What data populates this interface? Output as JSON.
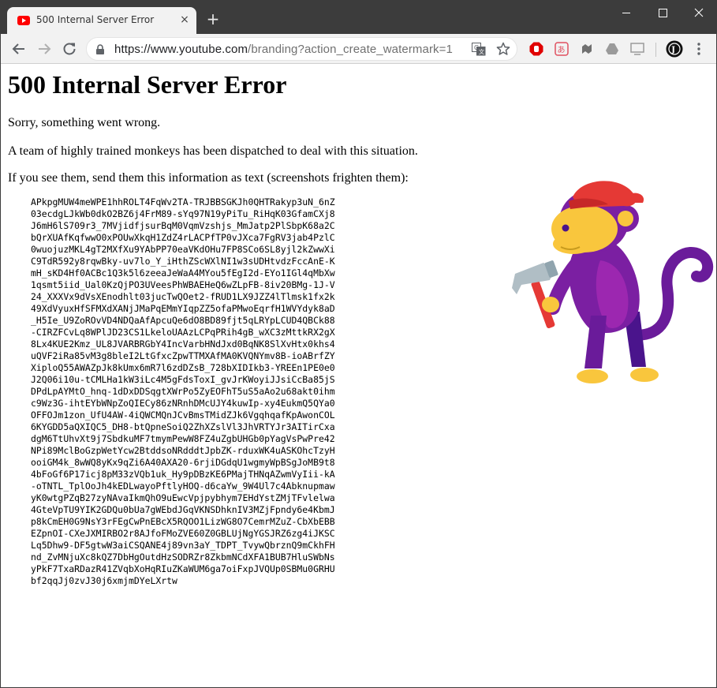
{
  "browser": {
    "tab": {
      "title": "500 Internal Server Error",
      "favicon": "youtube-icon"
    },
    "new_tab_label": "+",
    "tab_close_label": "×",
    "url_host": "https://www.youtube.com",
    "url_rest": "/branding?action_create_watermark=1",
    "colors": {
      "titlebar": "#3c3c3c",
      "toolbar": "#f2f2f2",
      "accent_red": "#ff0000"
    }
  },
  "page": {
    "title": "500 Internal Server Error",
    "line1": "Sorry, something went wrong.",
    "line2": "A team of highly trained monkeys has been dispatched to deal with this situation.",
    "line3": "If you see them, send them this information as text (screenshots frighten them):",
    "trace_lines": [
      "APkpgMUW4meWPE1hhROLT4FqWv2TA-TRJBBSGKJh0QHTRakyp3uN_6nZ",
      "03ecdgLJkWb0dkO2BZ6j4FrM89-sYq97N19yPiTu_RiHqK03GfamCXj8",
      "J6mH6lS709r3_7MVjidfjsurBqM0VqmVzshjs_MmJatp2PlSbpK68a2C",
      "bQrXUAfKqfwwO0xPOUwXkqH1ZdZ4rLACPfTP0vJXca7FgRV3jab4PzlC",
      "0wuojuzMKL4gT2MXfXu9YAbPP70eaVKdOHu7FP8SCo6SL8yjl2kZwwXi",
      "C9TdR592y8rqwBky-uv7lo_Y_iHthZScWXlNI1w3sUDHtvdzFccAnE-K",
      "mH_sKD4Hf0ACBc1Q3k5l6zeeaJeWaA4MYou5fEgI2d-EYo1IGl4qMbXw",
      "1qsmt5iid_Ual0KzQjPO3UVeesPhWBAEHeQ6wZLpFB-8iv20BMg-1J-V",
      "24_XXXVx9dVsXEnodhlt03jucTwQOet2-fRUD1LX9JZZ4lTlmsk1fx2k",
      "49XdVyuxHfSFMXdXANjJMaPqEMmYIqpZZ5ofaPMwoEqrfH1WVYdyk8aD",
      "_H5Ie_U9ZoROvVD4NDQaAfApcuQe6dO8BD89fjt5qLRYpLCUD4QBCk88",
      "-CIRZFCvLq8WPlJD23CS1LkeloUAAzLCPqPRih4gB_wXC3zMttkRX2gX",
      "8Lx4KUE2Kmz_UL8JVARBRGbY4IncVarbHNdJxd0BqNK8SlXvHtx0khs4",
      "uQVF2iRa85vM3g8bleI2LtGfxcZpwTTMXAfMA0KVQNYmv8B-ioABrfZY",
      "XiploQ55AWAZpJk8kUmx6mR7l6zdDZsB_728bXIDIkb3-YREEn1PE0e0",
      "J2Q06i10u-tCMLHa1kW3iLc4M5gFdsToxI_gvJrKWoyiJJsiCcBa85jS",
      "DPdLpAYMtO_hnq-1dDxDDSqgtXWrPo5ZyEOFhT5uS5aAo2u68akt0ihm",
      "c9Wz3G-ihtEYbWNpZoQIECy86zNRnhDMcUJY4kuwIp-xy4EukmQ5QYa0",
      "OFFOJm1zon_UfU4AW-4iQWCMQnJCvBmsTMidZJk6VgqhqafKpAwonCOL",
      "6KYGDD5aQXIQC5_DH8-btQpneSoiQ2ZhXZslVl3JhVRTYJr3AITirCxa",
      "dgM6TtUhvXt9j7SbdkuMF7tmymPewW8FZ4uZgbUHGb0pYagVsPwPre42",
      "NPi89MclBoGzpWetYcw2BtddsoNRdddtJpbZK-rduxWK4uASKOhcTzyH",
      "ooiGM4k_8wWQ8yKx9qZi6A40AXA20-6rjiDGdqU1wgmyWpBSgJoMB9t8",
      "4bFoGf6P17icj8pM33zVQb1uk_Hy9pDBzKE6PMajTHNqAZwmVyIii-kA",
      "-oTNTL_TplOoJh4kEDLwayoPftlyHOQ-d6caYw_9W4Ul7c4Abknupmaw",
      "yK0wtgPZqB27zyNAvaIkmQhO9uEwcVpjpybhym7EHdYstZMjTFvlelwa",
      "4GteVpTU9YIK2GDQu0bUa7gWEbdJGqVKNSDhknIV3MZjFpndy6e4KbmJ",
      "p8kCmEH0G9NsY3rFEgCwPnEBcX5RQOO1LizWG8O7CemrMZuZ-CbXbEBB",
      "EZpnOI-CXeJXMIRBO2r8AJfoFMoZVE60Z0GBLUjNgYGSJRZ6zg4iJKSC",
      "Lq5Dhw9-DF5gtwW3aiCSQANE4j89vn3aY_TDPT_TvywQbrznQ9mCkhFH",
      "nd_ZvMNjuXc8kQZ7DbHgOutdHzSODRZr8ZkbmNCdXFA1BUB7HluSWbNs",
      "yPkF7TxaRDazR41ZVqbXoHqRIuZKaWUM6ga7oiFxpJVQUp0SBMu0GRHU",
      "bf2qqJj0zvJ30j6xmjmDYeLXrtw"
    ],
    "illustration": "monkey-with-hammer"
  }
}
